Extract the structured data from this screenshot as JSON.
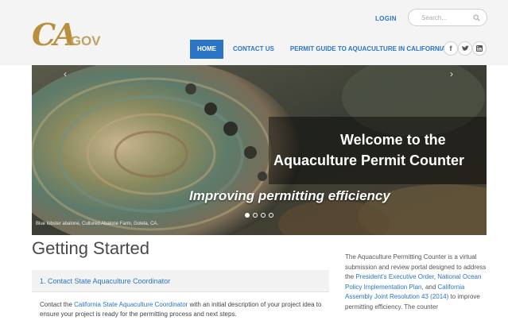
{
  "header": {
    "logo": {
      "ca": "CA",
      "gov": ".GOV"
    },
    "login_label": "LOGIN",
    "search": {
      "placeholder": "Search..."
    },
    "nav": [
      {
        "label": "HOME",
        "active": true
      },
      {
        "label": "CONTACT US",
        "active": false
      },
      {
        "label": "PERMIT GUIDE TO AQUACULTURE IN CALIFORNIA",
        "active": false
      }
    ],
    "social": [
      {
        "icon": "facebook-icon",
        "glyph": "f"
      },
      {
        "icon": "twitter-icon",
        "glyph": "t"
      },
      {
        "icon": "linkedin-icon",
        "glyph": "in"
      }
    ]
  },
  "hero": {
    "title_line1": "Welcome to the",
    "title_line2": "Aquaculture Permit Counter",
    "tagline": "Improving permitting efficiency",
    "caption": "Blue lobster abalone, Cultured Abalone Farm, Goleta, CA.",
    "prev_icon": "chevron-left-icon",
    "next_icon": "chevron-right-icon",
    "slides": 4,
    "active_slide": 0
  },
  "main": {
    "heading": "Getting Started",
    "step": {
      "title": "1. Contact State Aquaculture Coordinator",
      "body_prefix": "Contact the ",
      "body_link": "California State Aquaculture Coordinator",
      "body_suffix": " with an initial description of your project idea to ensure your project is ready for the permitting process and next steps."
    }
  },
  "sidebar": {
    "intro": "The Aquaculture Permitting Counter is a virtual submission and review portal designed to address the ",
    "link1": "President's Executive Order",
    "sep1": ", ",
    "link2": "National Ocean Policy Implementation Plan",
    "sep2": ", and ",
    "link3": "California Assembly Joint Resolution 43 (2014)",
    "outro": " to improve permitting efficiency. The counter"
  },
  "colors": {
    "accent": "#2b75c4",
    "logo_gold": "#b98f3c",
    "header_bg": "#f4f4f4"
  }
}
